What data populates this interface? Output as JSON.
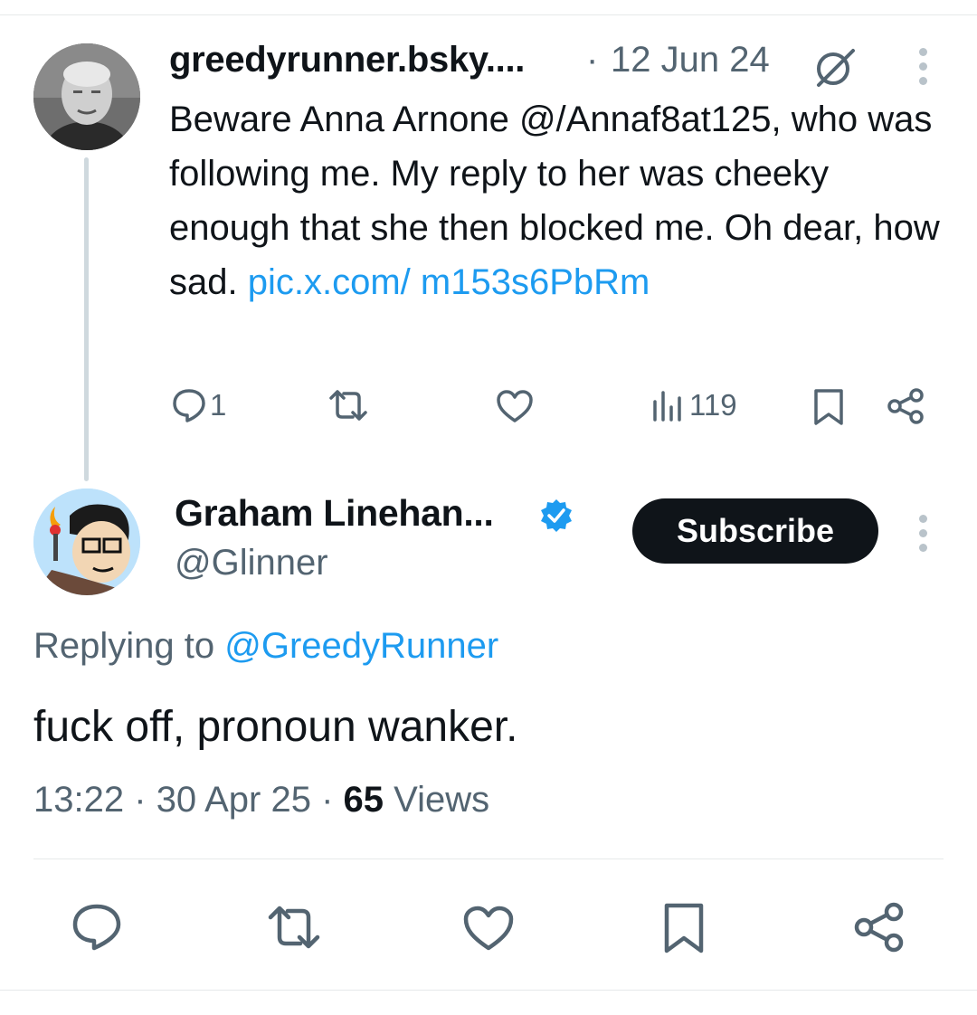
{
  "parent_tweet": {
    "display_name": "greedyrunner.bsky....",
    "separator": "·",
    "date": "12 Jun 24",
    "text_plain": "Beware Anna Arnone @/Annaf8at125, who was following me. My reply to her was cheeky enough that she then blocked me. Oh dear, how sad.",
    "text_link": "pic.x.com/ m153s6PbRm",
    "actions": {
      "replies": "1",
      "views": "119"
    }
  },
  "main_tweet": {
    "display_name": "Graham Linehan...",
    "handle": "@Glinner",
    "subscribe_label": "Subscribe",
    "replying_prefix": "Replying to",
    "replying_to": "@GreedyRunner",
    "text": "fuck off, pronoun wanker.",
    "time": "13:22",
    "date_sep": "·",
    "date": "30 Apr 25",
    "views_count": "65",
    "views_label": "Views"
  },
  "icons": [
    "grok-icon",
    "more-icon",
    "reply-icon",
    "repost-icon",
    "like-icon",
    "views-icon",
    "bookmark-icon",
    "share-icon",
    "verified-badge-icon"
  ],
  "colors": {
    "link": "#1d9bf0",
    "muted": "#536471",
    "text": "#0f1419",
    "button": "#0f1419"
  }
}
